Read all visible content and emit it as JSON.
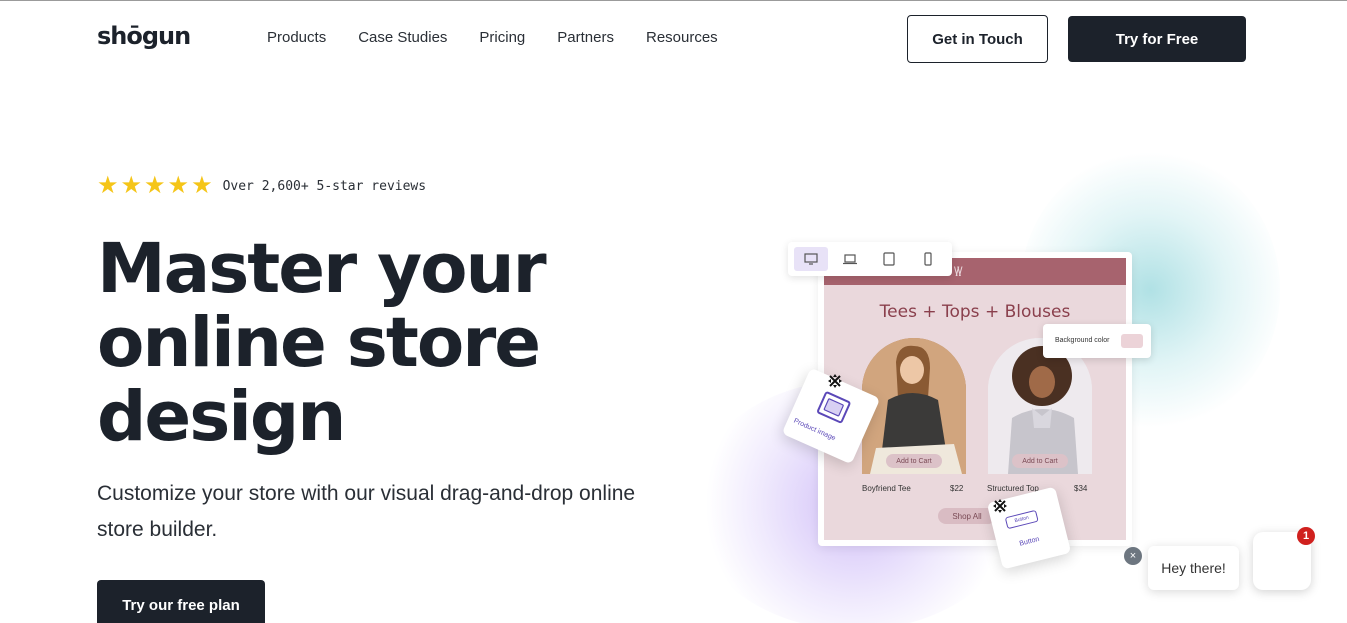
{
  "header": {
    "logo": "shōgun",
    "nav": [
      "Products",
      "Case Studies",
      "Pricing",
      "Partners",
      "Resources"
    ],
    "get_in_touch": "Get in Touch",
    "try_free": "Try for Free"
  },
  "hero": {
    "rating_stars": 5,
    "reviews_text": "Over 2,600+ 5-star reviews",
    "headline": "Master your online store design",
    "subheadline": "Customize your store with our visual drag-and-drop online store builder.",
    "cta": "Try our free plan"
  },
  "illustration": {
    "store_title": "Tees + Tops + Blouses",
    "add_to_cart": "Add to Cart",
    "products": [
      {
        "name": "Boyfriend Tee",
        "price": "$22"
      },
      {
        "name": "Structured Top",
        "price": "$34"
      }
    ],
    "shop_all": "Shop All",
    "background_color_label": "Background color",
    "product_image_label": "Product image",
    "button_label": "Button",
    "button_mini": "Button",
    "accent_color": "#a7636e",
    "editor_color": "#5b48b8"
  },
  "chat": {
    "greeting": "Hey there!",
    "badge": "1",
    "close": "×"
  }
}
